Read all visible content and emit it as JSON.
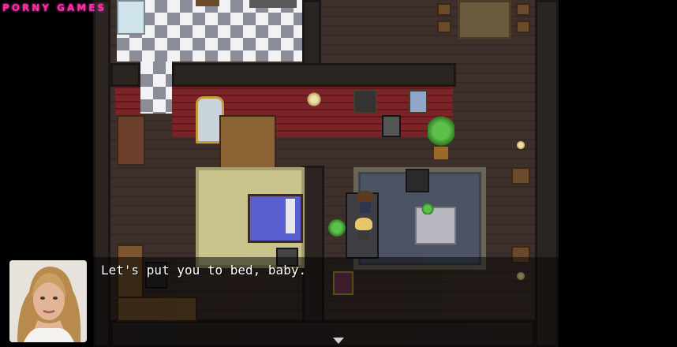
{
  "watermark": {
    "text": "PORNY GAMES"
  },
  "dialog": {
    "text": "Let's put you to bed, baby.",
    "speaker_portrait": "blonde-woman-portrait",
    "continue_icon": "down-triangle-icon"
  },
  "colors": {
    "watermark": "#ff2fa2",
    "brick_wall": "#7b2326",
    "floor": "#3d302b",
    "bed_sheet": "#5a5fd0",
    "rug": "#4c5363"
  }
}
